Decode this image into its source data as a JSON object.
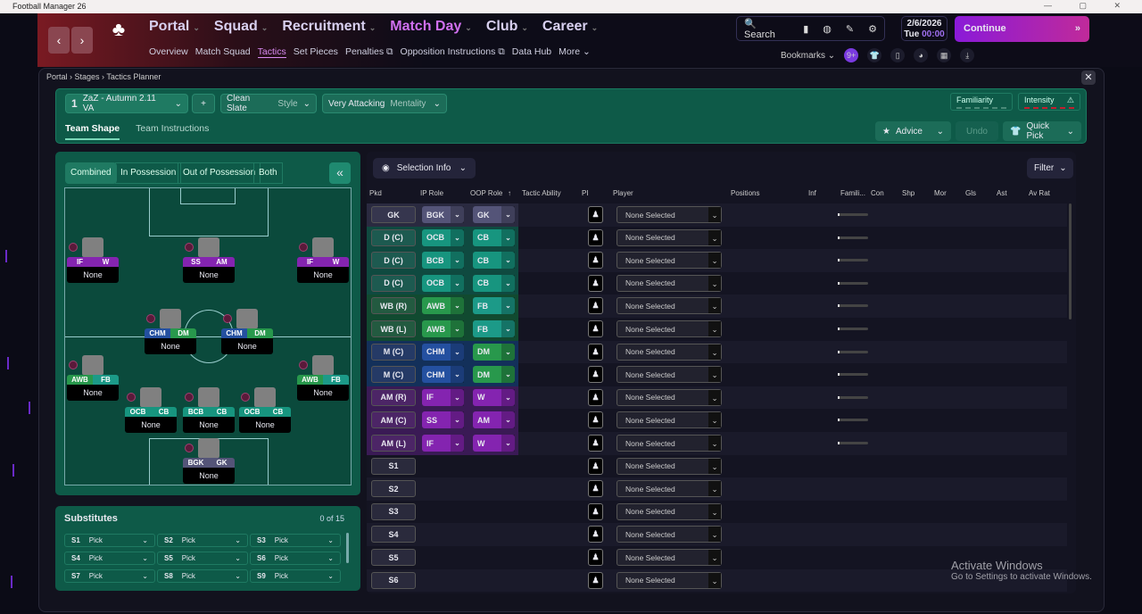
{
  "window": {
    "title": "Football Manager 26"
  },
  "header": {
    "nav": [
      {
        "label": "Portal"
      },
      {
        "label": "Squad"
      },
      {
        "label": "Recruitment"
      },
      {
        "label": "Match Day",
        "active": true
      },
      {
        "label": "Club"
      },
      {
        "label": "Career"
      }
    ],
    "subnav": [
      "Overview",
      "Match Squad",
      "Tactics",
      "Set Pieces",
      "Penalties ⧉",
      "Opposition Instructions ⧉",
      "Data Hub",
      "More ⌄"
    ],
    "active_subnav": "Tactics",
    "search_label": "Search",
    "date": "2/6/2026",
    "day": "Tue",
    "time": "00:00",
    "continue_label": "Continue",
    "bookmarks_label": "Bookmarks",
    "notification_badge": "9+",
    "accent": "#8a1ad8"
  },
  "breadcrumb": [
    "Portal",
    "Stages",
    "Tactics Planner"
  ],
  "tactic": {
    "slot": "1",
    "name": "ZaZ - Autumn 2.11 VA",
    "style_value": "Clean Slate",
    "style_label": "Style",
    "mentality_value": "Very Attacking",
    "mentality_label": "Mentality",
    "familiarity_label": "Familiarity",
    "intensity_label": "Intensity",
    "tabs": [
      "Team Shape",
      "Team Instructions"
    ],
    "advice_label": "Advice",
    "undo_label": "Undo",
    "quick_pick_label": "Quick Pick"
  },
  "pitch_tabs": [
    "Combined",
    "In Possession",
    "Out of Possession",
    "Both"
  ],
  "pitch_players": [
    {
      "ip": "IF",
      "oop": "W",
      "name": "None"
    },
    {
      "ip": "SS",
      "oop": "AM",
      "name": "None"
    },
    {
      "ip": "IF",
      "oop": "W",
      "name": "None"
    },
    {
      "ip": "CHM",
      "oop": "DM",
      "name": "None"
    },
    {
      "ip": "CHM",
      "oop": "DM",
      "name": "None"
    },
    {
      "ip": "AWB",
      "oop": "FB",
      "name": "None"
    },
    {
      "ip": "AWB",
      "oop": "FB",
      "name": "None"
    },
    {
      "ip": "OCB",
      "oop": "CB",
      "name": "None"
    },
    {
      "ip": "BCB",
      "oop": "CB",
      "name": "None"
    },
    {
      "ip": "OCB",
      "oop": "CB",
      "name": "None"
    },
    {
      "ip": "BGK",
      "oop": "GK",
      "name": "None"
    }
  ],
  "substitutes": {
    "title": "Substitutes",
    "count": "0 of 15",
    "slots": [
      {
        "id": "S1",
        "value": "Pick"
      },
      {
        "id": "S2",
        "value": "Pick"
      },
      {
        "id": "S3",
        "value": "Pick"
      },
      {
        "id": "S4",
        "value": "Pick"
      },
      {
        "id": "S5",
        "value": "Pick"
      },
      {
        "id": "S6",
        "value": "Pick"
      },
      {
        "id": "S7",
        "value": "Pick"
      },
      {
        "id": "S8",
        "value": "Pick"
      },
      {
        "id": "S9",
        "value": "Pick"
      }
    ]
  },
  "selection": {
    "view_label": "Selection Info",
    "filter_label": "Filter",
    "columns": [
      "Pkd",
      "IP Role",
      "OOP Role",
      "Tactic Ability",
      "PI",
      "Player",
      "Positions",
      "Inf",
      "Famili...",
      "Con",
      "Shp",
      "Mor",
      "Gls",
      "Ast",
      "Av Rat"
    ],
    "sort_indicator": "↑",
    "rows": [
      {
        "pos": "GK",
        "ip": "BGK",
        "oop": "GK",
        "player": "None Selected"
      },
      {
        "pos": "D (C)",
        "ip": "OCB",
        "oop": "CB",
        "player": "None Selected"
      },
      {
        "pos": "D (C)",
        "ip": "BCB",
        "oop": "CB",
        "player": "None Selected"
      },
      {
        "pos": "D (C)",
        "ip": "OCB",
        "oop": "CB",
        "player": "None Selected"
      },
      {
        "pos": "WB (R)",
        "ip": "AWB",
        "oop": "FB",
        "player": "None Selected"
      },
      {
        "pos": "WB (L)",
        "ip": "AWB",
        "oop": "FB",
        "player": "None Selected"
      },
      {
        "pos": "M (C)",
        "ip": "CHM",
        "oop": "DM",
        "player": "None Selected"
      },
      {
        "pos": "M (C)",
        "ip": "CHM",
        "oop": "DM",
        "player": "None Selected"
      },
      {
        "pos": "AM (R)",
        "ip": "IF",
        "oop": "W",
        "player": "None Selected"
      },
      {
        "pos": "AM (C)",
        "ip": "SS",
        "oop": "AM",
        "player": "None Selected"
      },
      {
        "pos": "AM (L)",
        "ip": "IF",
        "oop": "W",
        "player": "None Selected"
      },
      {
        "pos": "S1",
        "player": "None Selected"
      },
      {
        "pos": "S2",
        "player": "None Selected"
      },
      {
        "pos": "S3",
        "player": "None Selected"
      },
      {
        "pos": "S4",
        "player": "None Selected"
      },
      {
        "pos": "S5",
        "player": "None Selected"
      },
      {
        "pos": "S6",
        "player": "None Selected"
      }
    ]
  },
  "role_colors": {
    "BGK": "#545478",
    "GK": "#545478",
    "OCB": "#17957f",
    "BCB": "#17957f",
    "CB": "#17957f",
    "AWB": "#28984c",
    "FB": "#1c9a88",
    "CHM": "#2450a0",
    "DM": "#28984c",
    "IF": "#8424b0",
    "W": "#8424b0",
    "SS": "#8424b0",
    "AM": "#8424b0"
  },
  "watermark": {
    "title": "Activate Windows",
    "subtitle": "Go to Settings to activate Windows."
  }
}
